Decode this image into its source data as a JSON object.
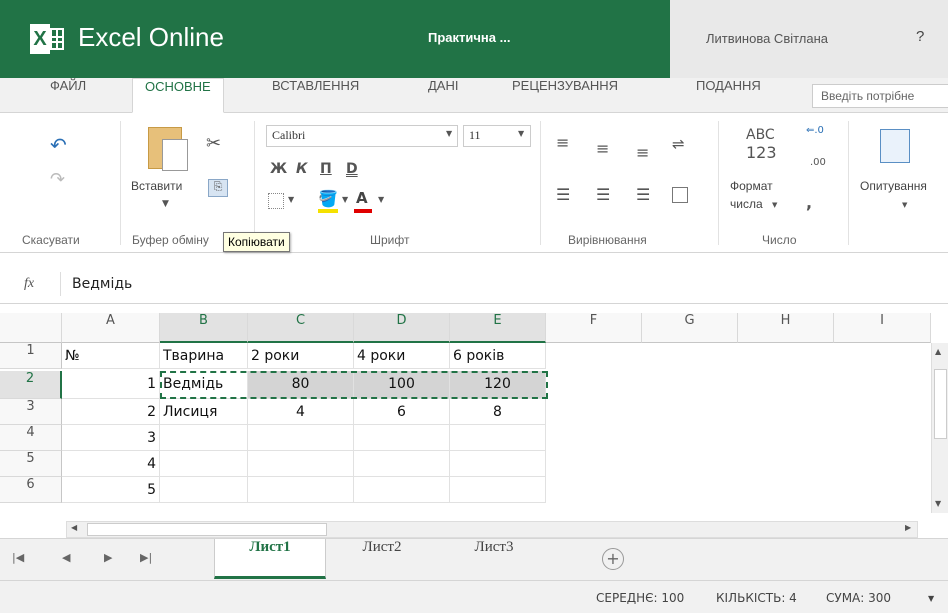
{
  "titlebar": {
    "app_name": "Excel Online",
    "doc_title": "Практична ...",
    "user_name": "Литвинова Світлана",
    "help": "?"
  },
  "tabs": [
    {
      "label": "ФАЙЛ",
      "active": false
    },
    {
      "label": "ОСНОВНЕ",
      "active": true
    },
    {
      "label": "ВСТАВЛЕННЯ",
      "active": false
    },
    {
      "label": "ДАНІ",
      "active": false
    },
    {
      "label": "РЕЦЕНЗУВАННЯ",
      "active": false
    },
    {
      "label": "ПОДАННЯ",
      "active": false
    }
  ],
  "tell_me_placeholder": "Введіть потрібне",
  "ribbon": {
    "undo_group": "Скасувати",
    "clipboard": {
      "paste": "Вставити",
      "group": "Буфер обміну",
      "tooltip": "Копіювати"
    },
    "font": {
      "name": "Calibri",
      "size": "11",
      "bold": "Ж",
      "italic": "К",
      "underline": "П",
      "double_underline": "D",
      "font_color_glyph": "A",
      "group": "Шрифт"
    },
    "alignment": {
      "group": "Вирівнювання"
    },
    "number": {
      "abc": "ABC",
      "num": "123",
      "format_line1": "Формат",
      "format_line2": "числа",
      "comma": ",",
      "group": "Число"
    },
    "styles": {
      "label": "Опитування"
    }
  },
  "formula": {
    "fx": "fx",
    "value": "Ведмідь"
  },
  "columns": [
    "A",
    "B",
    "C",
    "D",
    "E",
    "F",
    "G",
    "H",
    "I"
  ],
  "selected_columns": [
    "B",
    "C",
    "D",
    "E"
  ],
  "rows": [
    {
      "num": "1",
      "cells": [
        "№",
        "Тварина",
        "2 роки",
        "4 роки",
        "6 років"
      ]
    },
    {
      "num": "2",
      "cells": [
        "1",
        "Ведмідь",
        "80",
        "100",
        "120"
      ]
    },
    {
      "num": "3",
      "cells": [
        "2",
        "Лисиця",
        "4",
        "6",
        "8"
      ]
    },
    {
      "num": "4",
      "cells": [
        "3",
        "",
        "",
        "",
        ""
      ]
    },
    {
      "num": "5",
      "cells": [
        "4",
        "",
        "",
        "",
        ""
      ]
    },
    {
      "num": "6",
      "cells": [
        "5",
        "",
        "",
        "",
        ""
      ]
    }
  ],
  "selected_row": "2",
  "sheets": [
    {
      "label": "Лист1",
      "active": true
    },
    {
      "label": "Лист2",
      "active": false
    },
    {
      "label": "Лист3",
      "active": false
    }
  ],
  "status": {
    "average": "СЕРЕДНЄ: 100",
    "count": "КІЛЬКІСТЬ: 4",
    "sum": "СУМА: 300"
  },
  "colors": {
    "accent": "#217346",
    "selection": "#d4d4d4"
  }
}
